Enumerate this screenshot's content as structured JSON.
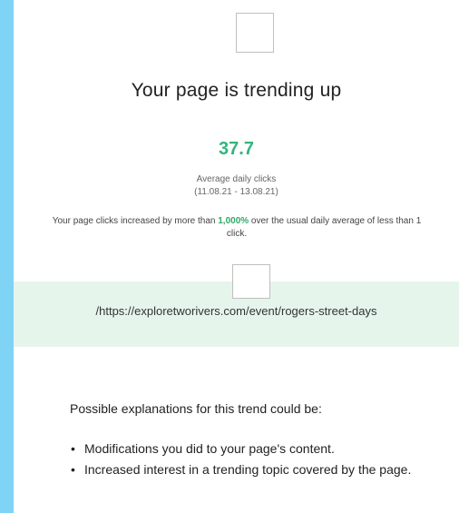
{
  "headline": "Your page is trending up",
  "metric": {
    "value": "37.7",
    "label": "Average daily clicks",
    "range": "(11.08.21 - 13.08.21)"
  },
  "summary": {
    "before": "Your page clicks increased by more than ",
    "percent": "1,000%",
    "after": " over the usual daily average of less than 1 click."
  },
  "page": {
    "url": "/https://exploretworivers.com/event/rogers-street-days"
  },
  "explanations": {
    "title": "Possible explanations for this trend could be:",
    "items": [
      "Modifications you did to your page's content.",
      "Increased interest in a trending topic covered by the page."
    ]
  },
  "colors": {
    "background": "#7fd3f5",
    "accent_green": "#33b57a",
    "panel_green": "#e5f5ec"
  }
}
